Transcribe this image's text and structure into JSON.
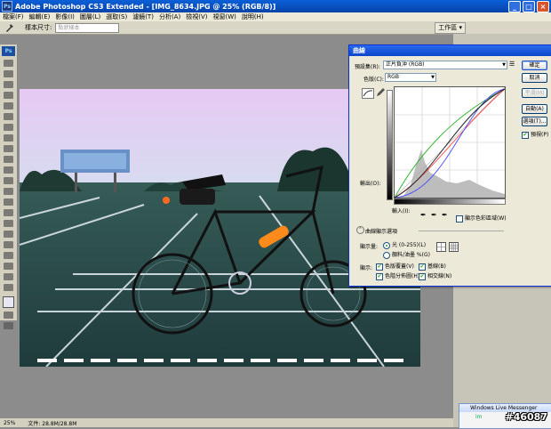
{
  "window": {
    "title": "Adobe Photoshop CS3 Extended - [IMG_8634.JPG @ 25% (RGB/8)]",
    "app_icon": "Ps"
  },
  "menubar": [
    "檔案(F)",
    "編輯(E)",
    "影像(I)",
    "圖層(L)",
    "選取(S)",
    "濾鏡(T)",
    "分析(A)",
    "檢視(V)",
    "視窗(W)",
    "說明(H)"
  ],
  "optbar": {
    "sample_label": "樣本尺寸:",
    "sample_value": "點狀樣本",
    "workspace_label": "工作區 ▾"
  },
  "toolbox": {
    "logo": "Ps"
  },
  "statusbar": {
    "zoom": "25%",
    "doc": "文件: 28.8M/28.8M"
  },
  "msn": {
    "title": "Windows Live Messenger",
    "brand": "im"
  },
  "watermark": "#46087",
  "curves_dialog": {
    "title": "曲線",
    "preset_label": "預設集(R):",
    "preset_value": "正片負沖 (RGB)",
    "channel_label": "色版(C):",
    "channel_value": "RGB",
    "output_label": "輸出(O):",
    "input_label": "輸入(I):",
    "show_clipping": "顯示色彩區域(W)",
    "options_header": "曲線顯示選項",
    "show_amount_label": "顯示量:",
    "light_option": "光 (0-255)(L)",
    "pigment_option": "顏料/油墨 %(G)",
    "show_label": "顯示:",
    "checks": [
      "色版覆蓋(V)",
      "基線(B)",
      "色階分佈圖(H)",
      "相交線(N)"
    ],
    "buttons": {
      "ok": "確定",
      "cancel": "取消",
      "smooth": "平滑(M)",
      "auto": "自動(A)",
      "options": "選項(T)...",
      "preview": "預視(P)"
    }
  }
}
